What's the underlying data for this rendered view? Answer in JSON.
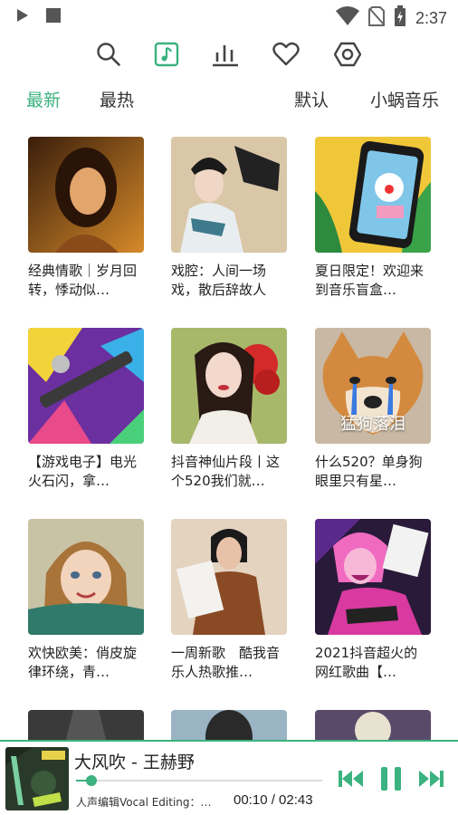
{
  "status_bar": {
    "time": "2:37",
    "icons": [
      "play-icon",
      "stop-square-icon",
      "wifi-icon",
      "no-sim-icon",
      "battery-charging-icon"
    ]
  },
  "top_nav": {
    "icons": [
      "search-icon",
      "music-library-icon",
      "chart-icon",
      "heart-icon",
      "settings-icon"
    ],
    "active": "music-library-icon",
    "accent_color": "#3bb27f"
  },
  "tabs": {
    "latest": "最新",
    "hottest": "最热",
    "default": "默认",
    "source": "小蜗音乐",
    "active": "latest"
  },
  "playlists": [
    {
      "title": "经典情歌｜岁月回转，悸动似…"
    },
    {
      "title": "戏腔：人间一场戏，散后辞故人"
    },
    {
      "title": "夏日限定！欢迎来到音乐盲盒…"
    },
    {
      "title": "【游戏电子】电光火石闪，拿…"
    },
    {
      "title": "抖音神仙片段丨这个520我们就…"
    },
    {
      "title": "什么520？单身狗眼里只有星…",
      "cover_text": "猛狗落泪"
    },
    {
      "title": "欢快欧美：俏皮旋律环绕，青…"
    },
    {
      "title": "一周新歌　酷我音乐人热歌推…"
    },
    {
      "title": "2021抖音超火的网红歌曲【…"
    }
  ],
  "player": {
    "title": "大风吹 - 王赫野",
    "subtitle": "人声编辑Vocal Editing：…",
    "time": "00:10 / 02:43",
    "progress": 0.061,
    "controls": [
      "previous-icon",
      "pause-icon",
      "next-icon"
    ]
  }
}
